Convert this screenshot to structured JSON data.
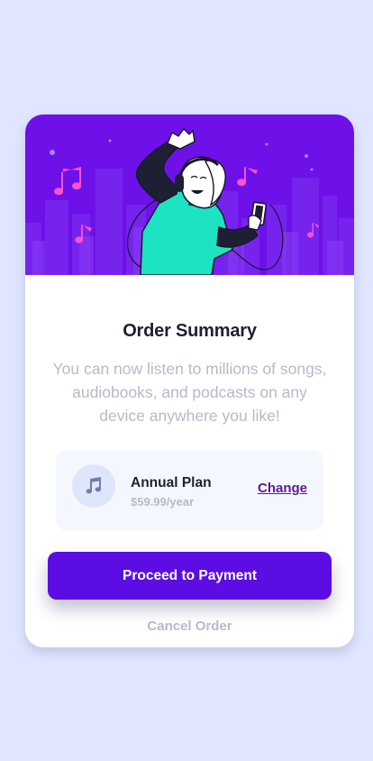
{
  "colors": {
    "page_background": "#e0e6ff",
    "hero_background": "#6d11e8",
    "accent": "#5b0de3",
    "change_link": "#5c1a8c",
    "muted_text": "#b8b9c9",
    "heading_text": "#1f2032",
    "plan_box_background": "#f5f7ff"
  },
  "hero": {
    "illustration": "person-dancing-with-headphones-illustration",
    "icons": [
      "music-note-icon",
      "music-note-icon",
      "music-note-icon",
      "music-note-icon"
    ]
  },
  "summary": {
    "title": "Order Summary",
    "description": "You can now listen to millions of songs, audiobooks, and podcasts on any device anywhere you like!"
  },
  "plan": {
    "icon": "music-note-icon",
    "name": "Annual Plan",
    "price": "$59.99/year",
    "change_label": "Change"
  },
  "actions": {
    "proceed_label": "Proceed to Payment",
    "cancel_label": "Cancel Order"
  }
}
